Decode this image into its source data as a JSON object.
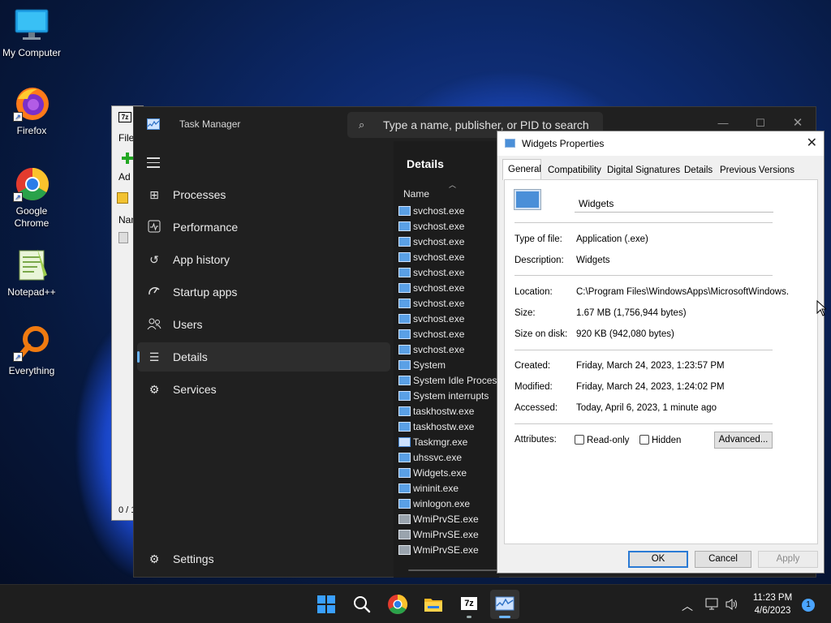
{
  "desktop": {
    "icons": [
      {
        "label": "My Computer",
        "icon": "monitor-icon"
      },
      {
        "label": "Firefox",
        "icon": "firefox-icon"
      },
      {
        "label": "Google Chrome",
        "icon": "chrome-icon"
      },
      {
        "label": "Notepad++",
        "icon": "notepadpp-icon"
      },
      {
        "label": "Everything",
        "icon": "everything-icon"
      }
    ]
  },
  "bg_window_7z": {
    "title_icon": "7z",
    "menu_file": "File",
    "add_label": "Ad",
    "col_name": "Nan",
    "status": "0 / 1"
  },
  "task_manager": {
    "title": "Task Manager",
    "search_placeholder": "Type a name, publisher, or PID to search",
    "nav": [
      {
        "label": "Processes",
        "icon": "processes-icon"
      },
      {
        "label": "Performance",
        "icon": "performance-icon"
      },
      {
        "label": "App history",
        "icon": "app-history-icon"
      },
      {
        "label": "Startup apps",
        "icon": "startup-apps-icon"
      },
      {
        "label": "Users",
        "icon": "users-icon"
      },
      {
        "label": "Details",
        "icon": "details-icon",
        "active": true
      },
      {
        "label": "Services",
        "icon": "services-icon"
      }
    ],
    "settings_label": "Settings",
    "details_heading": "Details",
    "column_name": "Name",
    "processes": [
      {
        "name": "svchost.exe",
        "icon": "app"
      },
      {
        "name": "svchost.exe",
        "icon": "app"
      },
      {
        "name": "svchost.exe",
        "icon": "app"
      },
      {
        "name": "svchost.exe",
        "icon": "app"
      },
      {
        "name": "svchost.exe",
        "icon": "app"
      },
      {
        "name": "svchost.exe",
        "icon": "app"
      },
      {
        "name": "svchost.exe",
        "icon": "app"
      },
      {
        "name": "svchost.exe",
        "icon": "app"
      },
      {
        "name": "svchost.exe",
        "icon": "app"
      },
      {
        "name": "svchost.exe",
        "icon": "app"
      },
      {
        "name": "System",
        "icon": "app"
      },
      {
        "name": "System Idle Process",
        "icon": "app"
      },
      {
        "name": "System interrupts",
        "icon": "app"
      },
      {
        "name": "taskhostw.exe",
        "icon": "app"
      },
      {
        "name": "taskhostw.exe",
        "icon": "app"
      },
      {
        "name": "Taskmgr.exe",
        "icon": "tm"
      },
      {
        "name": "uhssvc.exe",
        "icon": "app"
      },
      {
        "name": "Widgets.exe",
        "icon": "app"
      },
      {
        "name": "wininit.exe",
        "icon": "app"
      },
      {
        "name": "winlogon.exe",
        "icon": "app"
      },
      {
        "name": "WmiPrvSE.exe",
        "icon": "gear"
      },
      {
        "name": "WmiPrvSE.exe",
        "icon": "gear"
      },
      {
        "name": "WmiPrvSE.exe",
        "icon": "gear"
      }
    ]
  },
  "properties": {
    "title": "Widgets Properties",
    "tabs": [
      "General",
      "Compatibility",
      "Digital Signatures",
      "Details",
      "Previous Versions"
    ],
    "selected_tab": "General",
    "name_value": "Widgets",
    "type_label": "Type of file:",
    "type_value": "Application (.exe)",
    "desc_label": "Description:",
    "desc_value": "Widgets",
    "location_label": "Location:",
    "location_value": "C:\\Program Files\\WindowsApps\\MicrosoftWindows.",
    "size_label": "Size:",
    "size_value": "1.67 MB (1,756,944 bytes)",
    "size_disk_label": "Size on disk:",
    "size_disk_value": "920 KB (942,080 bytes)",
    "created_label": "Created:",
    "created_value": "Friday, March 24, 2023, 1:23:57 PM",
    "modified_label": "Modified:",
    "modified_value": "Friday, March 24, 2023, 1:24:02 PM",
    "accessed_label": "Accessed:",
    "accessed_value": "Today, April 6, 2023, 1 minute ago",
    "attributes_label": "Attributes:",
    "readonly_label": "Read-only",
    "hidden_label": "Hidden",
    "advanced_label": "Advanced...",
    "ok_label": "OK",
    "cancel_label": "Cancel",
    "apply_label": "Apply"
  },
  "taskbar": {
    "apps": [
      "start-icon",
      "search-icon",
      "chrome-icon",
      "file-explorer-icon",
      "7zip-icon",
      "task-manager-icon"
    ],
    "time": "11:23 PM",
    "date": "4/6/2023",
    "notification_count": "1"
  },
  "colors": {
    "accent": "#6cb5ff",
    "dialog_default_button": "#2a7ad5"
  }
}
